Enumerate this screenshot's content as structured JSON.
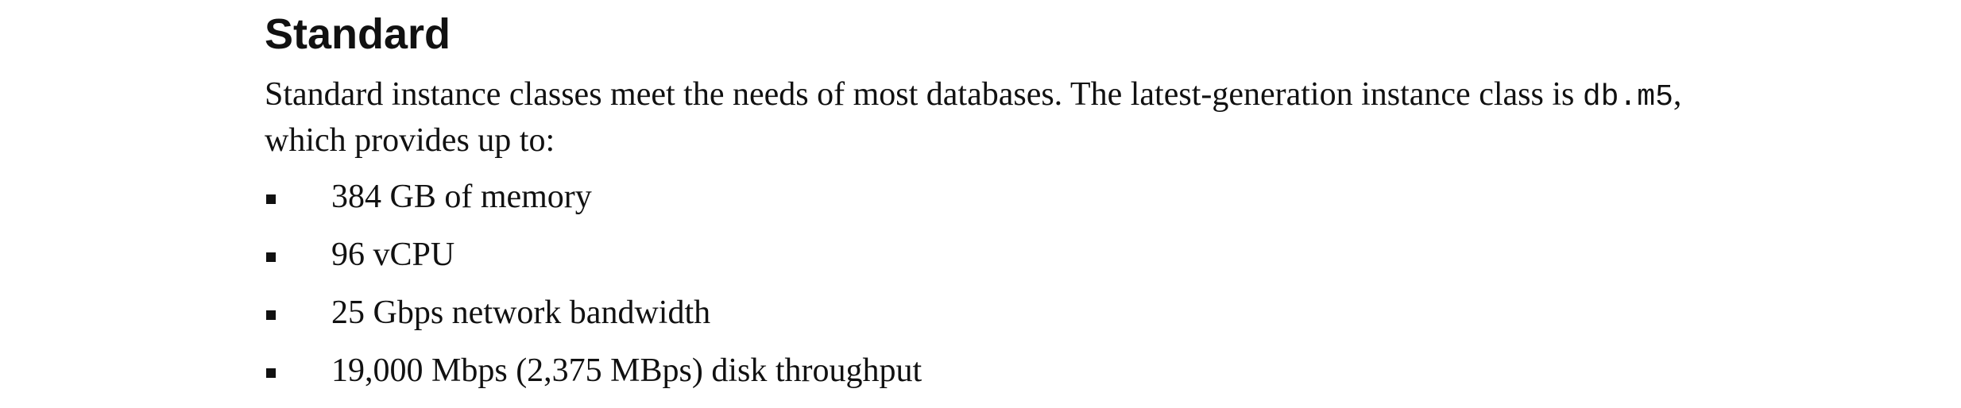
{
  "section": {
    "heading": "Standard",
    "intro_part1": "Standard instance classes meet the needs of most databases. The latest-generation instance class is ",
    "intro_code": "db.m5",
    "intro_part2": ", which provides up to:"
  },
  "bullets": [
    "384 GB of memory",
    "96 vCPU",
    "25 Gbps network bandwidth",
    "19,000 Mbps (2,375 MBps) disk throughput"
  ],
  "icons": {
    "bullet": "square-bullet-icon"
  }
}
